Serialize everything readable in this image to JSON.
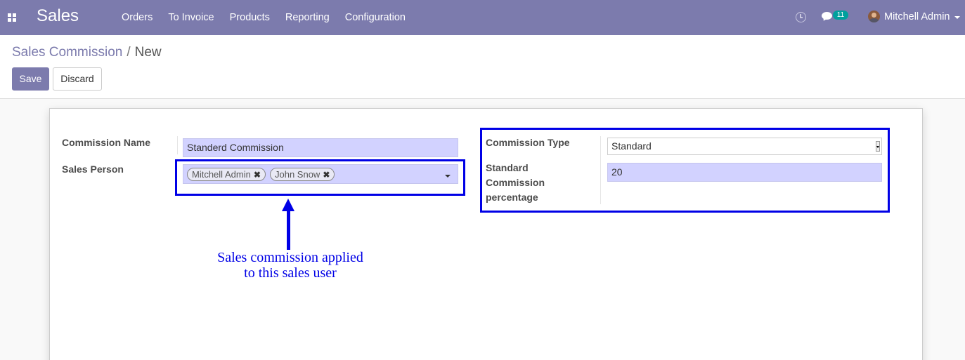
{
  "navbar": {
    "app_name": "Sales",
    "menu": [
      "Orders",
      "To Invoice",
      "Products",
      "Reporting",
      "Configuration"
    ],
    "message_count": "11",
    "user_name": "Mitchell Admin"
  },
  "breadcrumb": {
    "parent": "Sales Commission",
    "separator": "/",
    "current": "New"
  },
  "buttons": {
    "save": "Save",
    "discard": "Discard"
  },
  "form": {
    "commission_name_label": "Commission Name",
    "commission_name_value": "Standerd Commission",
    "sales_person_label": "Sales Person",
    "sales_person_tags": [
      "Mitchell Admin",
      "John Snow"
    ],
    "commission_type_label": "Commission Type",
    "commission_type_value": "Standard",
    "standard_pct_label_lines": [
      "Standard",
      "Commission",
      "percentage"
    ],
    "standard_pct_value": "20"
  },
  "annotation": {
    "lines": [
      "Sales commission applied",
      "to this sales user"
    ],
    "color": "#0000e6"
  },
  "colors": {
    "brand": "#7c7bad",
    "input_bg": "#d2d2ff",
    "badge": "#00a09d"
  }
}
